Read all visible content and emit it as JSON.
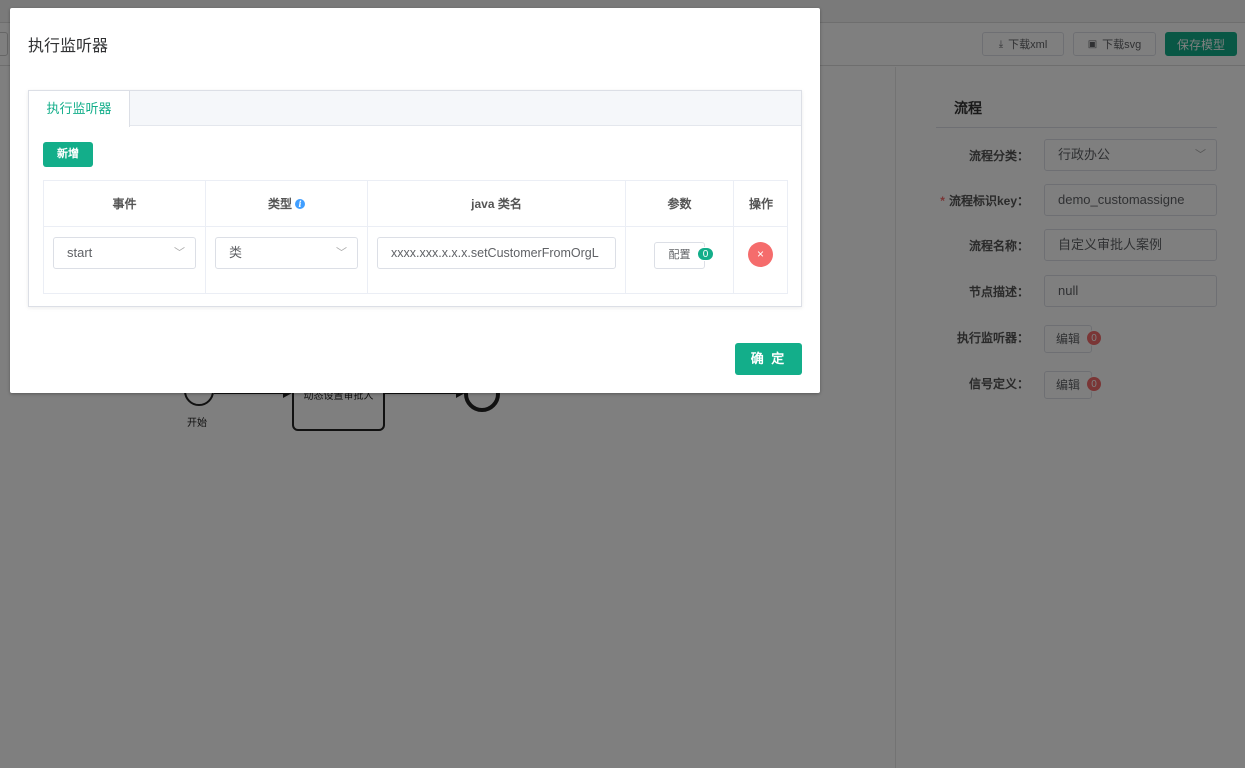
{
  "toolbar": {
    "download_xml": "下载xml",
    "download_svg": "下载svg",
    "save_model": "保存模型"
  },
  "canvas": {
    "start_label": "开始",
    "task_label": "动态设置审批人"
  },
  "panel": {
    "title": "流程",
    "fields": {
      "category": {
        "label": "流程分类：",
        "value": "行政办公"
      },
      "key": {
        "label": "流程标识key：",
        "value": "demo_customassigne"
      },
      "name": {
        "label": "流程名称：",
        "value": "自定义审批人案例"
      },
      "description": {
        "label": "节点描述：",
        "value": "null"
      },
      "listener": {
        "label": "执行监听器：",
        "button": "编辑",
        "count": "0"
      },
      "signal": {
        "label": "信号定义：",
        "button": "编辑",
        "count": "0"
      }
    }
  },
  "dialog": {
    "title": "执行监听器",
    "tab": "执行监听器",
    "add_button": "新增",
    "table": {
      "headers": {
        "event": "事件",
        "type": "类型",
        "java_class": "java 类名",
        "params": "参数",
        "action": "操作"
      },
      "rows": [
        {
          "event": "start",
          "type": "类",
          "java_class": "xxxx.xxx.x.x.x.setCustomerFromOrgL",
          "config_button": "配置",
          "config_count": "0",
          "delete": "×"
        }
      ]
    },
    "ok_button": "确 定"
  },
  "colors": {
    "primary": "#13ae8a",
    "danger": "#f56c6c",
    "info": "#409eff"
  }
}
